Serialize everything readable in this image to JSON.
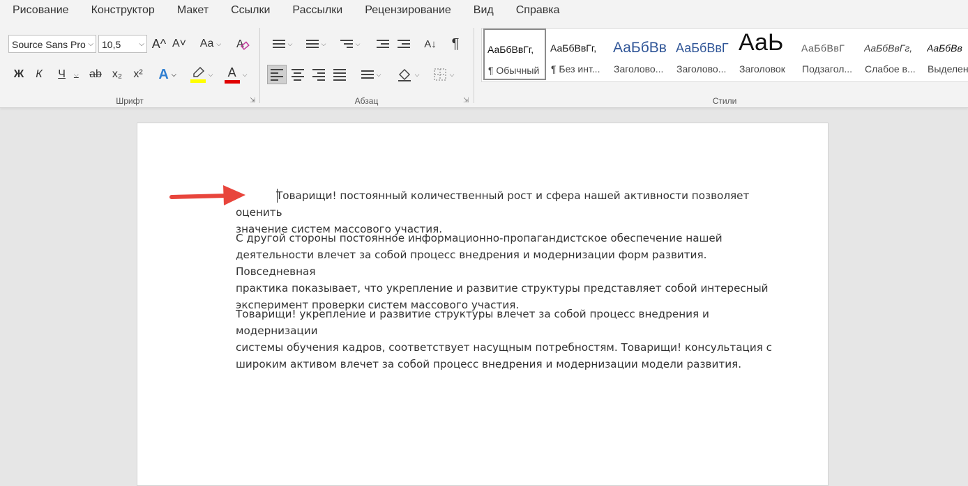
{
  "tabs": [
    "Рисование",
    "Конструктор",
    "Макет",
    "Ссылки",
    "Рассылки",
    "Рецензирование",
    "Вид",
    "Справка"
  ],
  "font": {
    "family": "Source Sans Pro",
    "size": "10,5",
    "grow": "A^",
    "shrink": "A˅",
    "case": "Aa",
    "bold": "Ж",
    "italic": "К",
    "underline": "Ч",
    "strike": "ab",
    "sub": "x₂",
    "sup": "x²",
    "effects": "A",
    "color_letter": "A",
    "highlight_color": "#ffff00",
    "font_color": "#e00000",
    "label": "Шрифт"
  },
  "paragraph": {
    "sort": "A↓",
    "pilcrow": "¶",
    "label": "Абзац"
  },
  "styles": {
    "label": "Стили",
    "items": [
      {
        "sample": "АаБбВвГг,",
        "name": "¶ Обычный"
      },
      {
        "sample": "АаБбВвГг,",
        "name": "¶ Без инт..."
      },
      {
        "sample": "АаБбВв",
        "name": "Заголово..."
      },
      {
        "sample": "АаБбВвГ",
        "name": "Заголово..."
      },
      {
        "sample": "АаЬ",
        "name": "Заголовок"
      },
      {
        "sample": "АаБбВвГ",
        "name": "Подзагол..."
      },
      {
        "sample": "АаБбВвГг,",
        "name": "Слабое в..."
      },
      {
        "sample": "АаБбВв",
        "name": "Выделен"
      }
    ]
  },
  "document": {
    "paragraphs": [
      [
        "Товарищи! постоянный количественный рост и сфера нашей активности позволяет оценить",
        "значение систем массового участия."
      ],
      [
        "С другой стороны постоянное информационно-пропагандистское обеспечение нашей",
        "деятельности влечет за собой процесс внедрения и модернизации форм развития. Повседневная",
        "практика показывает, что укрепление и развитие структуры представляет собой интересный",
        "эксперимент проверки систем массового участия."
      ],
      [
        "Товарищи! укрепление и развитие структуры влечет за собой процесс внедрения и модернизации",
        "системы обучения кадров, соответствует насущным потребностям. Товарищи! консультация с",
        "широким активом влечет за собой процесс внедрения и модернизации модели развития."
      ]
    ]
  },
  "annotation": {
    "arrow_color": "#e8453c"
  }
}
